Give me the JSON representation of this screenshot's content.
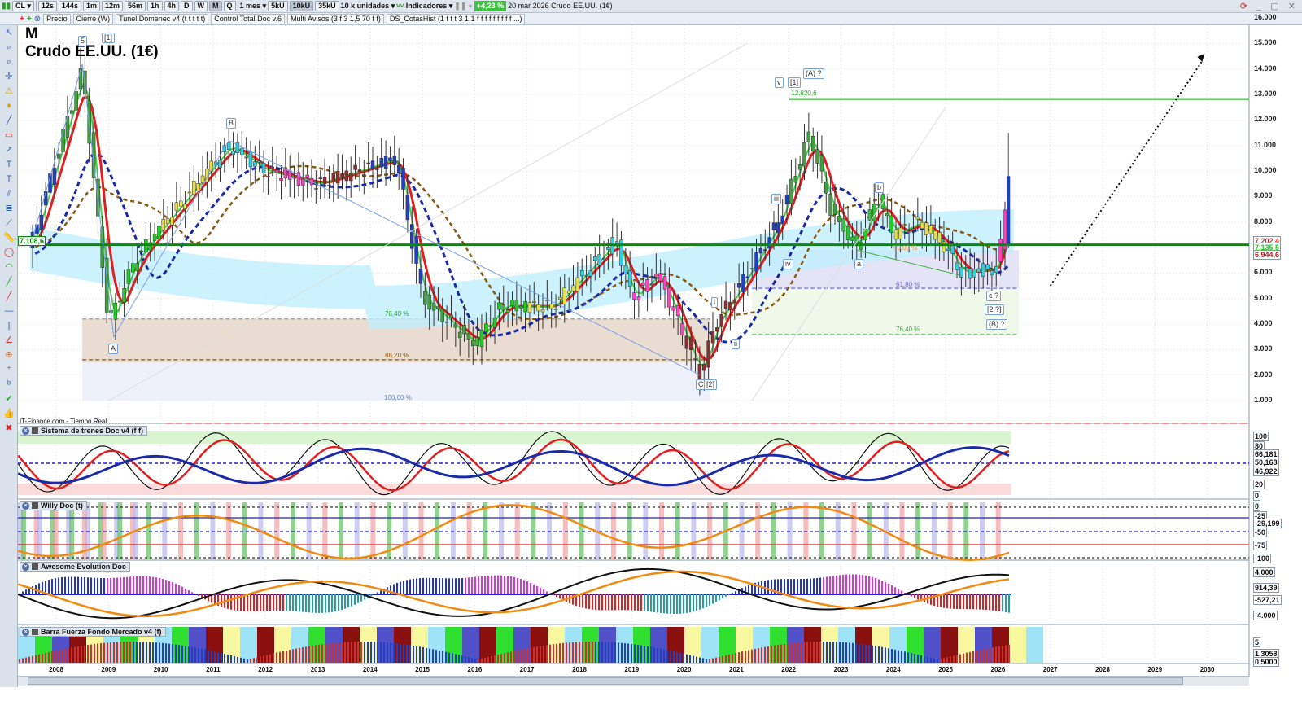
{
  "toolbar": {
    "symbol": "CL",
    "periods": [
      "12s",
      "144s",
      "1m",
      "12m",
      "56m",
      "1h",
      "4h",
      "D",
      "W",
      "M",
      "Q"
    ],
    "active_period": "M",
    "interval_select": "1 mes",
    "units": [
      "5kU",
      "10kU",
      "35kU"
    ],
    "active_unit": "10kU",
    "units_select": "10 k unidades",
    "indicators_label": "Indicadores",
    "change_pct": "+4,23 %",
    "date_title": "20 mar 2026 Crudo EE.UU. (1€)"
  },
  "overlays": [
    "Precio",
    "Cierre (W)",
    "Tunel Domenec v4 (t t t t t)",
    "Control Total Doc v.6",
    "Multi Avisos (3 f 3 1,5 70 f f)",
    "DS_CotasHist (1 t t t 3 1 1 f f f f f f f f f ...)"
  ],
  "chart": {
    "period_label": "M",
    "instrument": "Crudo EE.UU. (1€)",
    "source": "IT-Finance.com - Tiempo Real",
    "price_axis": [
      "16.000",
      "15.000",
      "14.000",
      "13.000",
      "12.000",
      "11.000",
      "10.000",
      "9.000",
      "8.000",
      "7.000",
      "6.000",
      "5.000",
      "4.000",
      "3.000",
      "2.000",
      "1.000"
    ],
    "price_tags": {
      "high": "7.202,4",
      "last": "7.135,5",
      "low": "6.944,6"
    },
    "left_tag": "7.108,6",
    "level_label": "12.820,6",
    "wave_labels": [
      "5",
      "[1]",
      "A",
      "B",
      "C",
      "[2]",
      "i",
      "ii",
      "iii",
      "iv",
      "v",
      "[1]",
      "(A) ?",
      "a",
      "b",
      "c ?",
      "[2 ?]",
      "(B) ?"
    ],
    "fib_labels": [
      "76,40 %",
      "88,20 %",
      "100,00 %",
      "50,00 %",
      "61,80 %",
      "76,40 %"
    ],
    "years": [
      "2008",
      "2009",
      "2010",
      "2011",
      "2012",
      "2013",
      "2014",
      "2015",
      "2016",
      "2017",
      "2018",
      "2019",
      "2020",
      "2021",
      "2022",
      "2023",
      "2024",
      "2025",
      "2026",
      "2027",
      "2028",
      "2029",
      "2030"
    ],
    "colors": {
      "support": "#0a8a0a",
      "resistance": "#22aa22",
      "ma_fast": "#e02020",
      "ma_slow": "#1a2aa8",
      "ma_brown": "#8a5a10"
    }
  },
  "chart_data": {
    "type": "candlestick",
    "title": "Crudo EE.UU. (1€)",
    "x": [
      2007.5,
      2008.5,
      2009.0,
      2009.5,
      2010.0,
      2011.3,
      2012.0,
      2013.0,
      2014.5,
      2015.0,
      2016.0,
      2016.5,
      2017.5,
      2018.7,
      2019.0,
      2019.5,
      2020.3,
      2020.6,
      2021.0,
      2021.8,
      2022.4,
      2022.8,
      2023.3,
      2023.7,
      2024.0,
      2024.5,
      2025.0,
      2025.3,
      2026.0,
      2026.2
    ],
    "y": [
      7000,
      14000,
      4000,
      6500,
      7800,
      11000,
      10000,
      9500,
      10500,
      5000,
      3200,
      4700,
      4700,
      7300,
      5000,
      6000,
      2000,
      4000,
      5300,
      8000,
      11500,
      8500,
      7000,
      9000,
      7500,
      8000,
      7000,
      6000,
      6200,
      9800
    ],
    "ylim": [
      500,
      16300
    ]
  },
  "panels": [
    {
      "name": "Sistema de trenes Doc v4 (f f)",
      "axis": [
        "100",
        "80",
        "66,181",
        "50,168",
        "46,922",
        "20",
        "0"
      ]
    },
    {
      "name": "Willy Doc (t)",
      "axis": [
        "0",
        "-25",
        "-29,199",
        "-50",
        "-75",
        "-100"
      ]
    },
    {
      "name": "Awesome Evolution Doc",
      "axis": [
        "4.000",
        "914,39",
        "-527,21",
        "-4.000"
      ]
    },
    {
      "name": "Barra Fuerza Fondo Mercado v4 (f)",
      "axis": [
        "5",
        "1,3058",
        "0,5000"
      ]
    }
  ]
}
